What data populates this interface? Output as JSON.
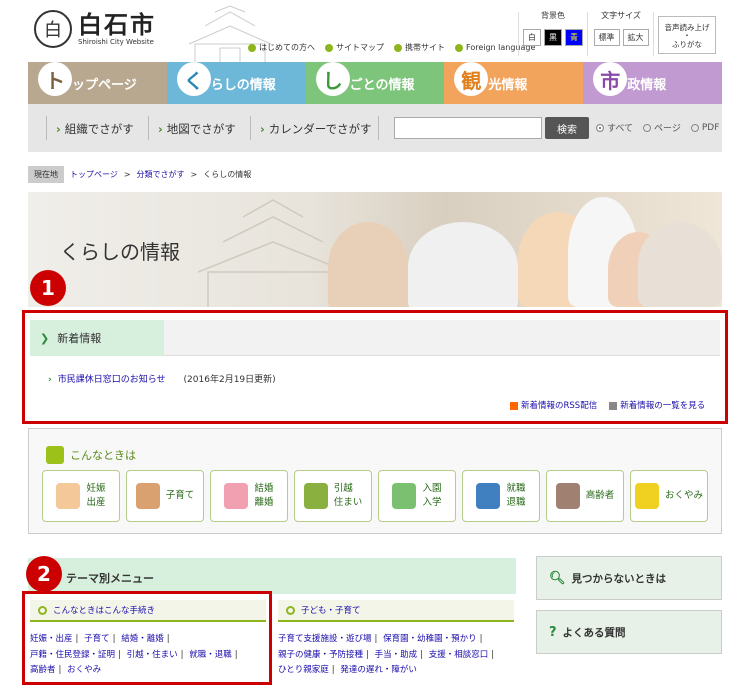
{
  "header": {
    "logo_mark": "白",
    "title": "白石市",
    "subtitle": "Shiroishi City Website",
    "links": [
      "はじめての方へ",
      "サイトマップ",
      "携帯サイト",
      "Foreign language"
    ],
    "bg_color_label": "背景色",
    "bg_buttons": [
      "白",
      "黒",
      "青"
    ],
    "font_size_label": "文字サイズ",
    "font_buttons": [
      "標準",
      "拡大"
    ],
    "voice_line1": "音声読み上げ",
    "voice_line2": "・",
    "voice_line3": "ふりがな"
  },
  "nav": {
    "tabs": [
      {
        "big": "ト",
        "label": "ップページ",
        "color": "#b8a890",
        "big_color": "#7a6040"
      },
      {
        "big": "く",
        "label": "らしの情報",
        "color": "#6db8d8",
        "big_color": "#2a88b8"
      },
      {
        "big": "し",
        "label": "ごとの情報",
        "color": "#7cc57a",
        "big_color": "#3a9a3a"
      },
      {
        "big": "観",
        "label": "光情報",
        "color": "#f3a45c",
        "big_color": "#e0801e"
      },
      {
        "big": "市",
        "label": "政情報",
        "color": "#c09ad0",
        "big_color": "#8a4aa8"
      }
    ]
  },
  "search": {
    "links": [
      "組織でさがす",
      "地図でさがす",
      "カレンダーでさがす"
    ],
    "button": "検索",
    "options": [
      "すべて",
      "ページ",
      "PDF"
    ]
  },
  "breadcrumb": {
    "here": "現在地",
    "items": [
      "トップページ",
      "分類でさがす"
    ],
    "sep": ">",
    "current": "くらしの情報"
  },
  "hero": {
    "title": "くらしの情報"
  },
  "callouts": {
    "one": "1",
    "two": "2"
  },
  "news": {
    "title": "新着情報",
    "item_link": "市民課休日窓口のお知らせ",
    "item_date": "(2016年2月19日更新)",
    "rss": "新着情報のRSS配信",
    "list": "新着情報の一覧を見る"
  },
  "konna": {
    "title": "こんなときは",
    "buttons": [
      {
        "l1": "妊娠",
        "l2": "出産",
        "color": "#f5c89a"
      },
      {
        "l1": "子育て",
        "l2": "",
        "color": "#d9a070"
      },
      {
        "l1": "結婚",
        "l2": "離婚",
        "color": "#f0a0b0"
      },
      {
        "l1": "引越",
        "l2": "住まい",
        "color": "#8ab040"
      },
      {
        "l1": "入園",
        "l2": "入学",
        "color": "#7ac070"
      },
      {
        "l1": "就職",
        "l2": "退職",
        "color": "#4080c0"
      },
      {
        "l1": "高齢者",
        "l2": "",
        "color": "#a08070"
      },
      {
        "l1": "おくやみ",
        "l2": "",
        "color": "#f0d020"
      }
    ]
  },
  "theme": {
    "title": "テーマ別メニュー",
    "left_sub": "こんなときはこんな手続き",
    "left_links": [
      "妊娠・出産",
      "子育て",
      "結婚・離婚",
      "戸籍・住民登録・証明",
      "引越・住まい",
      "就職・退職",
      "高齢者",
      "おくやみ"
    ],
    "right_sub": "子ども・子育て",
    "right_links": [
      "子育て支援施設・遊び場",
      "保育園・幼稚園・預かり",
      "親子の健康・予防接種",
      "手当・助成",
      "支援・相談窓口",
      "ひとり親家庭",
      "発達の遅れ・障がい"
    ]
  },
  "side": {
    "notfound": "見つからないときは",
    "faq": "よくある質問"
  }
}
